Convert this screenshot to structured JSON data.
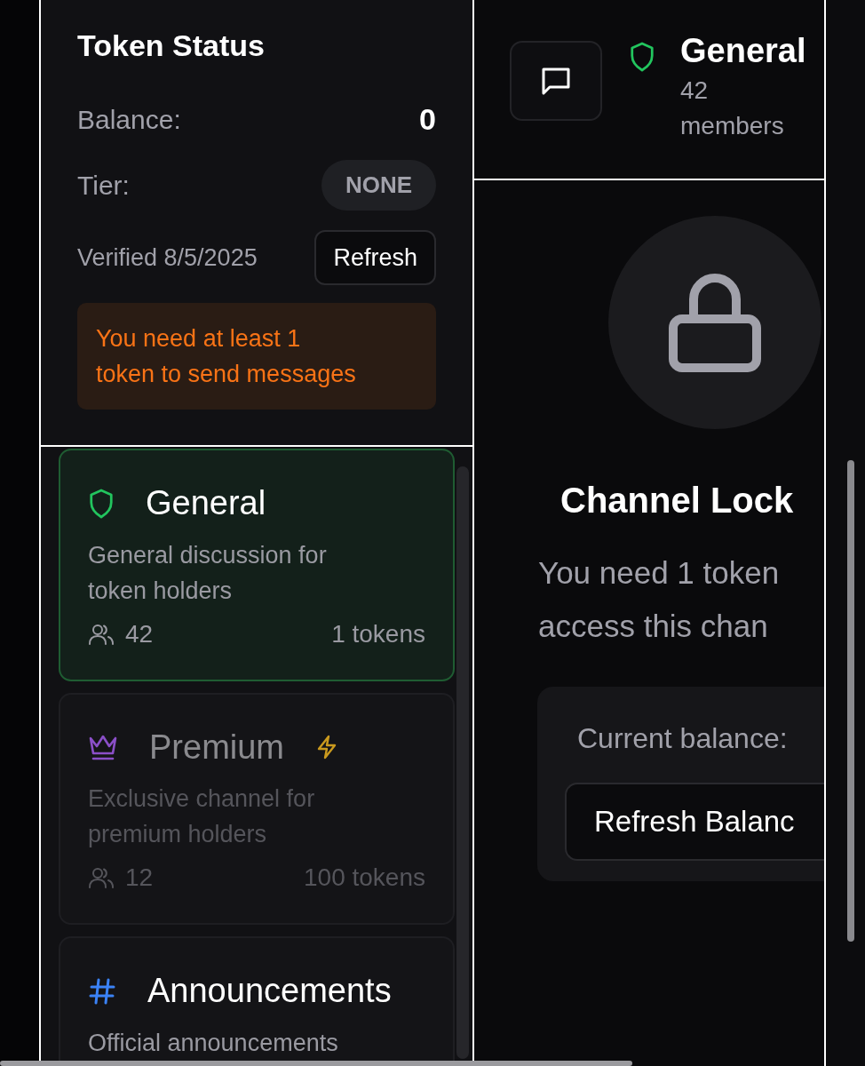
{
  "token_status": {
    "title": "Token Status",
    "balance_label": "Balance:",
    "balance": "0",
    "tier_label": "Tier:",
    "tier": "NONE",
    "verified": "Verified 8/5/2025",
    "refresh_button": "Refresh",
    "warning": "You need at least 1 token to send messages"
  },
  "channels": [
    {
      "name": "General",
      "kind": "shield",
      "description": "General discussion for token holders",
      "members": "42",
      "requirement": "1 tokens",
      "selected": true,
      "locked": false,
      "premium_badge": false
    },
    {
      "name": "Premium",
      "kind": "crown",
      "description": "Exclusive channel for premium holders",
      "members": "12",
      "requirement": "100 tokens",
      "selected": false,
      "locked": true,
      "premium_badge": true
    },
    {
      "name": "Announcements",
      "kind": "hash",
      "description": "Official announcements",
      "selected": false,
      "locked": false,
      "premium_badge": false
    }
  ],
  "channel_header": {
    "name": "General",
    "kind": "shield",
    "members": "42 members"
  },
  "locked_view": {
    "title": "Channel Lock",
    "message_lines": [
      "You need 1 token",
      "access this chan"
    ],
    "balance_label": "Current balance:",
    "button": "Refresh Balanc"
  }
}
